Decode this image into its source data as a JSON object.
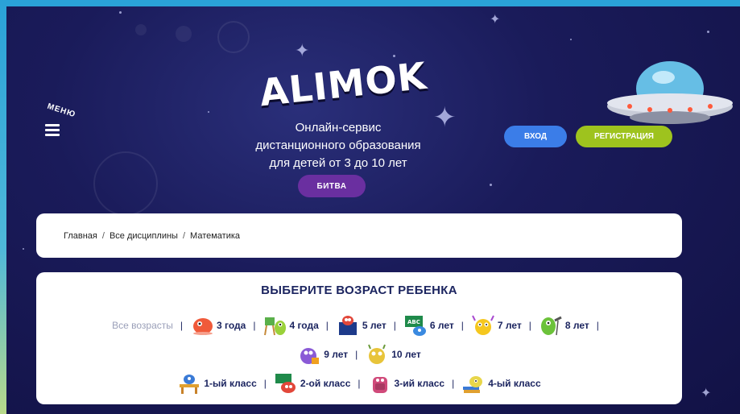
{
  "header": {
    "menu_label": "МЕНЮ",
    "logo": "ALIMOK",
    "tagline": [
      "Онлайн-сервис",
      "дистанционного образования",
      "для детей от 3 до 10 лет"
    ],
    "battle_button": "БИТВА",
    "login_button": "ВХОД",
    "register_button": "РЕГИСТРАЦИЯ"
  },
  "breadcrumb": [
    "Главная",
    "Все дисциплины",
    "Математика"
  ],
  "age_selector": {
    "title": "ВЫБЕРИТЕ ВОЗРАСТ РЕБЕНКА",
    "all_ages": "Все возрасты",
    "ages": [
      {
        "label": "3 года",
        "icon": "monster-red-icon"
      },
      {
        "label": "4 года",
        "icon": "monster-green-easel-icon"
      },
      {
        "label": "5 лет",
        "icon": "monster-red-board-icon"
      },
      {
        "label": "6 лет",
        "icon": "monster-blue-abc-icon"
      },
      {
        "label": "7 лет",
        "icon": "monster-yellow-icon"
      },
      {
        "label": "8 лет",
        "icon": "monster-green-telescope-icon"
      },
      {
        "label": "9 лет",
        "icon": "monster-purple-icon"
      },
      {
        "label": "10 лет",
        "icon": "monster-yellow-horned-icon"
      }
    ],
    "grades": [
      {
        "label": "1-ый класс",
        "icon": "monster-desk-icon"
      },
      {
        "label": "2-ой класс",
        "icon": "monster-red-board-icon"
      },
      {
        "label": "3-ий класс",
        "icon": "monster-pink-backpack-icon"
      },
      {
        "label": "4-ый класс",
        "icon": "monster-books-icon"
      }
    ]
  },
  "colors": {
    "space_bg": "#1a1b5a",
    "battle": "#6a2fa0",
    "login": "#3b7de8",
    "register": "#9ec31e",
    "title": "#1c2560"
  }
}
